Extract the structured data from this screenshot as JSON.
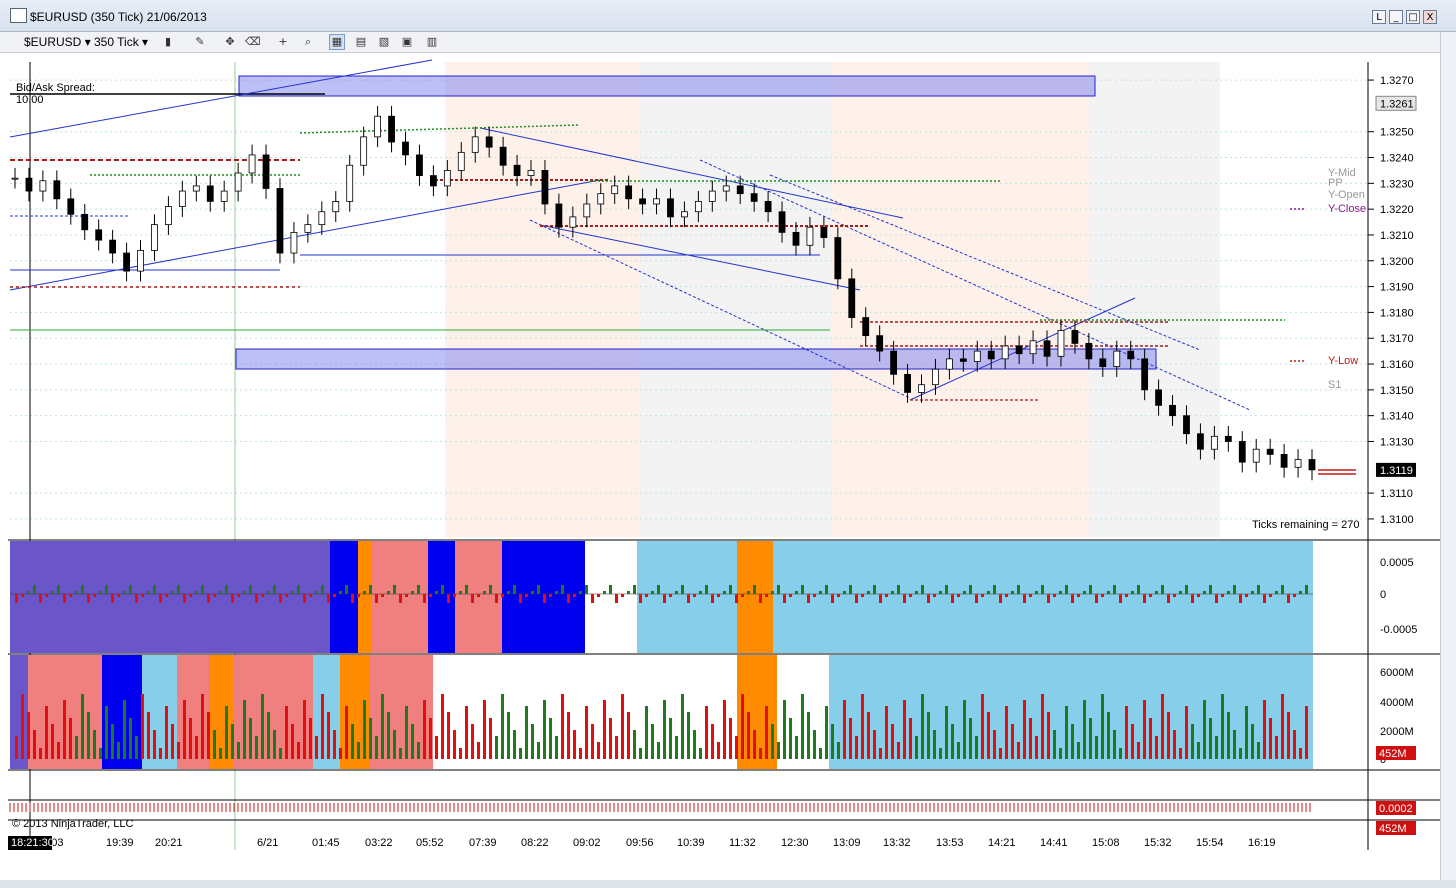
{
  "window": {
    "title": "$EURUSD (350 Tick)  21/06/2013",
    "buttons": {
      "restore_label": "L",
      "minimize_label": "_",
      "maximize_label": "□",
      "close_label": "X"
    }
  },
  "toolbar": {
    "instrument": "$EURUSD",
    "interval": "350 Tick",
    "icons": [
      "bars-icon",
      "pencil-icon",
      "crosshair-icon",
      "eraser-icon",
      "cross-cursor-icon",
      "zoom-icon",
      "data-box-icon",
      "indicators-icon",
      "strategies-icon",
      "properties-icon",
      "layout-icon"
    ]
  },
  "chart_data": {
    "type": "candlestick",
    "copyright": "© 2013 NinjaTrader, LLC",
    "spread_label": "Bid/Ask Spread:",
    "spread_value": "10.00",
    "ticks_remaining": "Ticks remaining = 270",
    "y_ticks": [
      "1.3270",
      "1.3250",
      "1.3240",
      "1.3230",
      "1.3220",
      "1.3210",
      "1.3200",
      "1.3190",
      "1.3180",
      "1.3170",
      "1.3160",
      "1.3150",
      "1.3140",
      "1.3130",
      "1.3110",
      "1.3100"
    ],
    "ylim": [
      1.3093,
      1.3277
    ],
    "current_price": "1.3119",
    "ask_marker": "1.3261",
    "pivot_labels": [
      "Y-Mid",
      "PP",
      "Y-Open",
      "Y-Close",
      "Y-Low",
      "S1"
    ],
    "x_ticks": [
      "19:03",
      "19:39",
      "20:21",
      "6/21",
      "01:45",
      "03:22",
      "05:52",
      "07:39",
      "08:22",
      "09:02",
      "09:56",
      "10:39",
      "11:32",
      "12:30",
      "13:09",
      "13:32",
      "13:53",
      "14:21",
      "14:41",
      "15:08",
      "15:32",
      "15:54",
      "16:19"
    ],
    "x_cursor_label": "18:21:30",
    "panel2_ticks": [
      "0.0005",
      "0",
      "-0.0005"
    ],
    "panel3_ticks": [
      "6000M",
      "4000M",
      "2000M",
      "0"
    ],
    "panel3_badge": "452M",
    "panel4_badge": "0.0002",
    "panel5_badge": "452M",
    "series": [
      {
        "name": "EURUSD",
        "close": [
          1.3232,
          1.3227,
          1.3231,
          1.3224,
          1.3218,
          1.3212,
          1.3208,
          1.3203,
          1.3196,
          1.3204,
          1.3214,
          1.3221,
          1.3227,
          1.3229,
          1.3223,
          1.3227,
          1.3234,
          1.3241,
          1.3228,
          1.3203,
          1.3211,
          1.3214,
          1.3219,
          1.3223,
          1.3237,
          1.3248,
          1.3256,
          1.3246,
          1.3241,
          1.3233,
          1.3229,
          1.3235,
          1.3242,
          1.3248,
          1.3244,
          1.3237,
          1.3233,
          1.3235,
          1.3222,
          1.3213,
          1.3217,
          1.3222,
          1.3226,
          1.3229,
          1.3224,
          1.3222,
          1.3224,
          1.3217,
          1.3219,
          1.3223,
          1.3227,
          1.3229,
          1.3226,
          1.3223,
          1.3219,
          1.3211,
          1.3206,
          1.3213,
          1.3209,
          1.3193,
          1.3178,
          1.3171,
          1.3165,
          1.3156,
          1.3149,
          1.3152,
          1.3158,
          1.3162,
          1.3161,
          1.3165,
          1.3162,
          1.3167,
          1.3164,
          1.3169,
          1.3163,
          1.3173,
          1.3168,
          1.3162,
          1.3159,
          1.3165,
          1.3162,
          1.315,
          1.3144,
          1.314,
          1.3133,
          1.3127,
          1.3132,
          1.313,
          1.3122,
          1.3127,
          1.3125,
          1.312,
          1.3123,
          1.3119
        ]
      }
    ],
    "annotations": [
      "Y-Mid",
      "PP",
      "Y-Open",
      "Y-Close",
      "Y-Low",
      "S1",
      "Bid/Ask Spread:"
    ]
  }
}
